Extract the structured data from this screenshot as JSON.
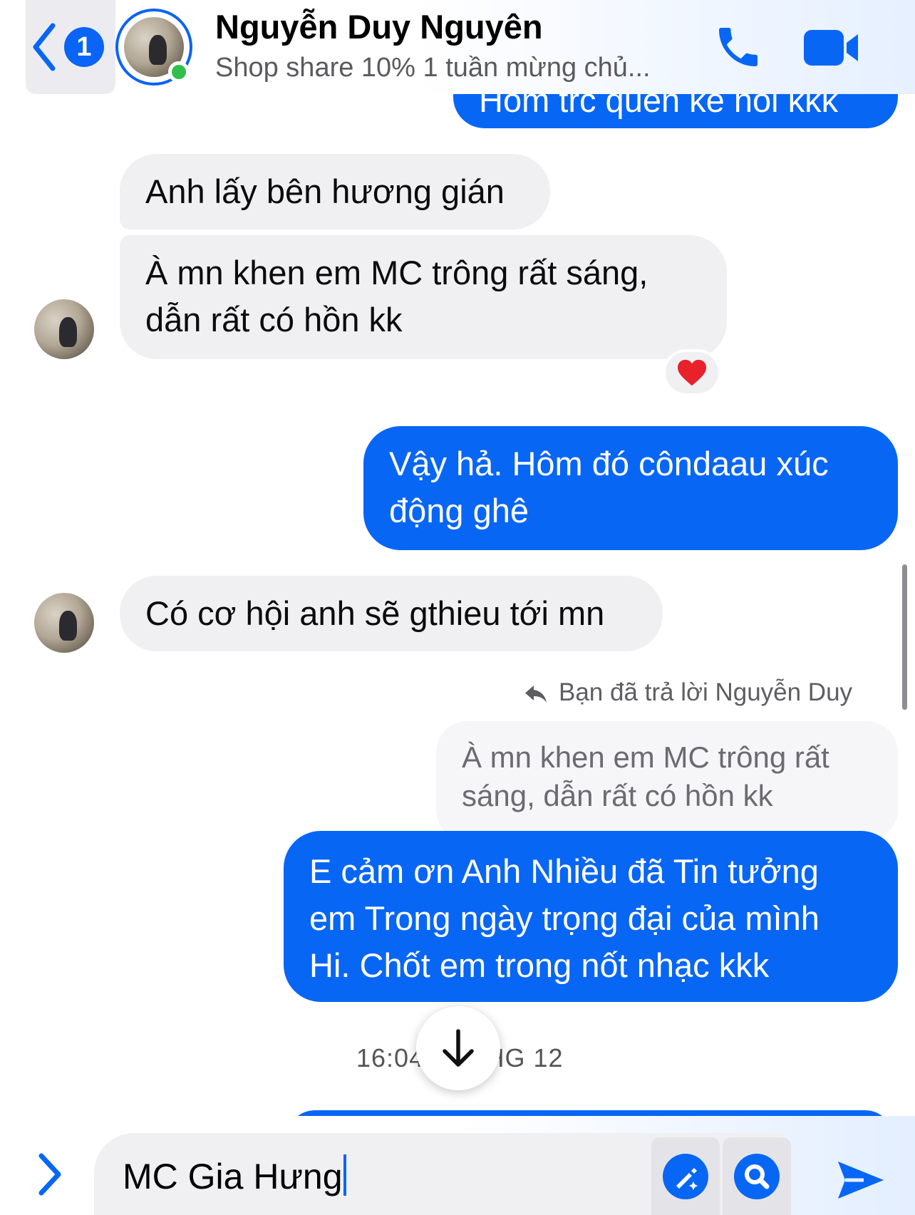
{
  "header": {
    "back_count": "1",
    "contact_name": "Nguyễn Duy Nguyên",
    "subtitle": "Shop share 10% 1 tuần mừng chủ..."
  },
  "colors": {
    "accent": "#0866f5",
    "incoming_bubble": "#f0f0f2",
    "online": "#2fbf4a"
  },
  "icons": {
    "back": "chevron-left-icon",
    "call": "phone-icon",
    "video": "video-camera-icon",
    "reaction": "heart-icon",
    "reply": "reply-arrow-icon",
    "scroll": "arrow-down-icon",
    "expand": "chevron-right-icon",
    "magic": "magic-wand-icon",
    "search": "search-icon",
    "send": "send-icon"
  },
  "messages": {
    "partial_top": "Hôm trc quên kể nói kkk",
    "m1": "Anh lấy bên hương gián",
    "m2_line1": "À mn khen em MC trông rất sáng,",
    "m2_line2": "dẫn rất có hồn kk",
    "m3_line1": "Vậy hả. Hôm đó côndaau xúc",
    "m3_line2": "động ghê",
    "m4": "Có cơ hội anh sẽ gthieu tới mn",
    "reply_note": "Bạn đã trả lời Nguyễn Duy",
    "quoted_line1": "À mn khen em MC trông rất",
    "quoted_line2": "sáng, dẫn rất có hồn kk",
    "m5_line1": "E cảm ơn Anh Nhiều đã Tin tưởng",
    "m5_line2": "em Trong ngày trọng đại của mình",
    "m5_line3": "Hi. Chốt em trong nốt nhạc kkk",
    "timestamp": "16:04 14 THG 12"
  },
  "composer": {
    "input_value": "MC Gia Hưng"
  }
}
